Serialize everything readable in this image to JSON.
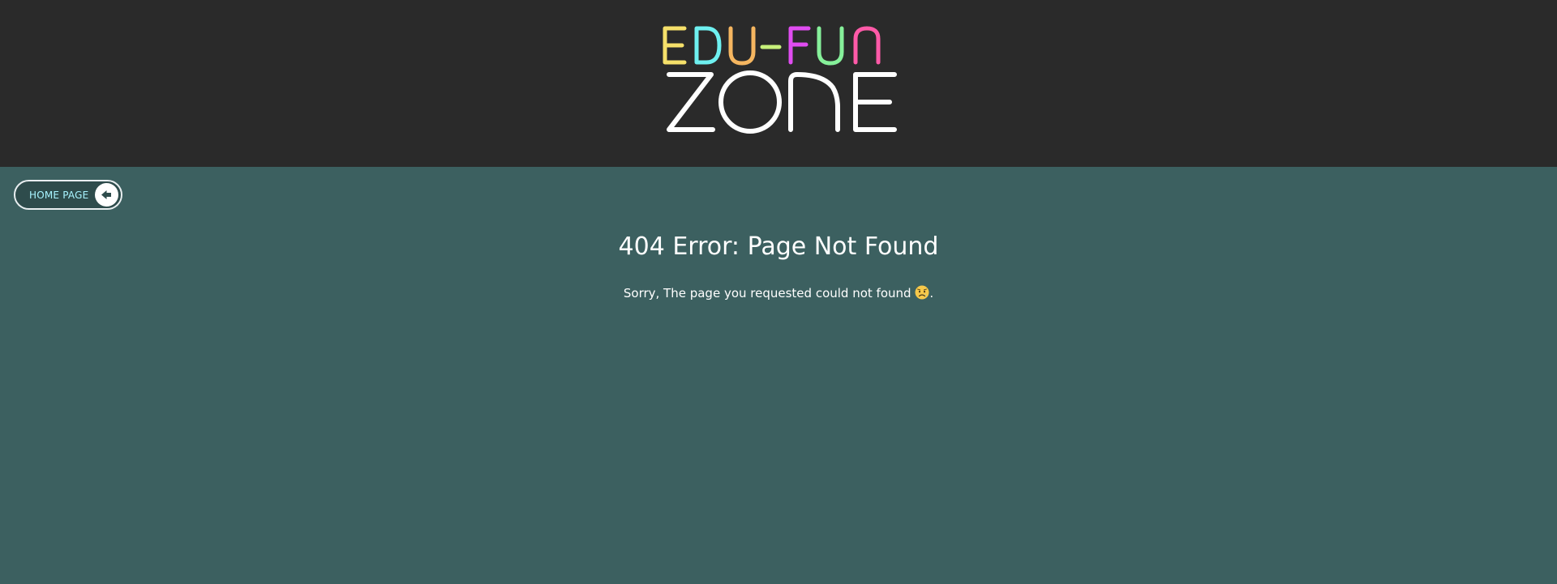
{
  "header": {
    "logo_line1": "EDU-FUN",
    "logo_line2": "ZONE",
    "logo_colors": [
      "#f5e06a",
      "#6ef0f0",
      "#f5b660",
      "#c7f07a",
      "#e04cf0",
      "#86f09a",
      "#ff5aa8"
    ]
  },
  "nav": {
    "home_label": "HOME PAGE",
    "home_icon": "back-arrow-icon"
  },
  "error": {
    "title": "404 Error: Page Not Found",
    "message": "Sorry, The page you requested could not found",
    "emoji": "sad-face-emoji",
    "trailing": "."
  },
  "colors": {
    "header_bg": "#2a2a2a",
    "main_bg": "#3c6060",
    "button_bg": "#2e4c4c",
    "button_text": "#a8f4ff"
  }
}
